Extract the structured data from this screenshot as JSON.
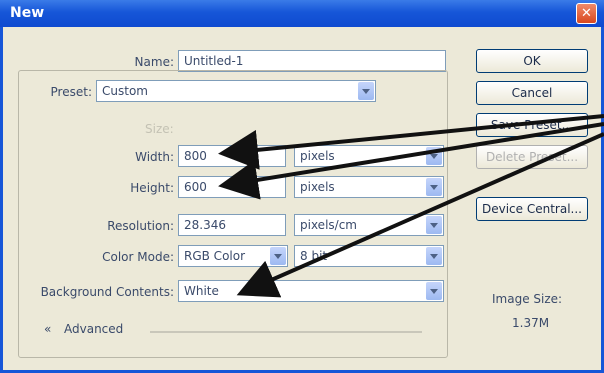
{
  "window": {
    "title": "New",
    "close_glyph": "✕"
  },
  "form": {
    "name_label": "Name:",
    "name_value": "Untitled-1",
    "preset_label": "Preset:",
    "preset_value": "Custom",
    "size_label": "Size:",
    "width_label": "Width:",
    "width_value": "800",
    "width_unit": "pixels",
    "height_label": "Height:",
    "height_value": "600",
    "height_unit": "pixels",
    "resolution_label": "Resolution:",
    "resolution_value": "28.346",
    "resolution_unit": "pixels/cm",
    "color_mode_label": "Color Mode:",
    "color_mode_value": "RGB Color",
    "bit_depth_value": "8 bit",
    "background_label": "Background Contents:",
    "background_value": "White",
    "advanced_label": "Advanced",
    "advanced_glyph": "«"
  },
  "buttons": {
    "ok": "OK",
    "cancel": "Cancel",
    "save_preset": "Save Preset...",
    "delete_preset": "Delete Preset...",
    "device_central": "Device Central..."
  },
  "image_size": {
    "label": "Image Size:",
    "value": "1.37M"
  },
  "colors": {
    "title_bar": "#1656d8",
    "dialog_bg": "#ece9d8",
    "arrow": "#111111"
  }
}
